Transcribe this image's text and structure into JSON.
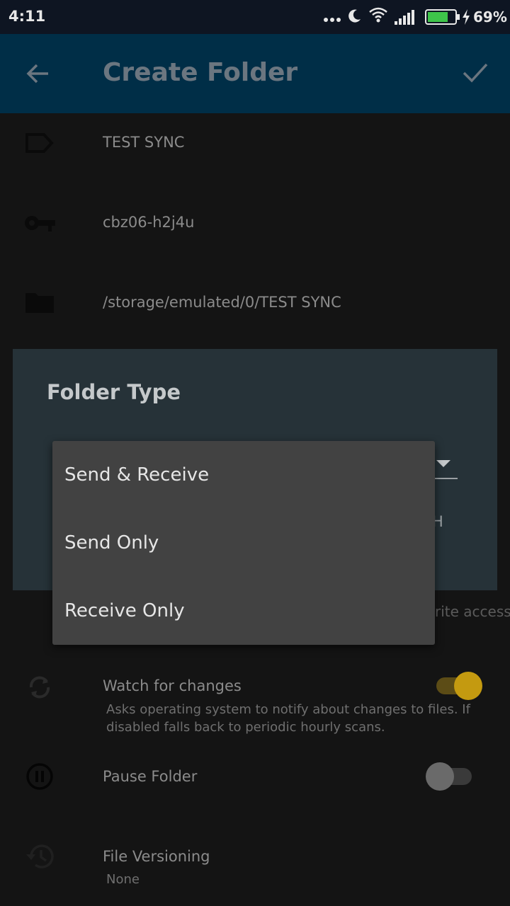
{
  "status_bar": {
    "time": "4:11",
    "battery_percent": "69%",
    "icons": [
      "more-dots-icon",
      "moon-icon",
      "wifi-icon",
      "signal-icon",
      "battery-icon",
      "charging-icon"
    ]
  },
  "app_bar": {
    "title": "Create Folder",
    "back_icon": "arrow-back-icon",
    "confirm_icon": "check-icon"
  },
  "fields": {
    "label": "TEST SYNC",
    "id": "cbz06-h2j4u",
    "path": "/storage/emulated/0/TEST SYNC"
  },
  "dialog": {
    "title": "Folder Type",
    "button_fragment": "H"
  },
  "folder_type_menu": {
    "options": [
      "Send & Receive",
      "Send Only",
      "Receive Only"
    ]
  },
  "background_partial_text": "rite access",
  "settings": {
    "watch": {
      "title": "Watch for changes",
      "description": "Asks operating system to notify about changes to files. If disabled falls back to periodic hourly scans.",
      "enabled": true
    },
    "pause": {
      "title": "Pause Folder",
      "enabled": false
    },
    "versioning": {
      "title": "File Versioning",
      "value": "None"
    }
  },
  "colors": {
    "app_bar": "#002e47",
    "status_bar": "#0e1522",
    "dialog": "#263238",
    "menu": "#424242",
    "toggle_on_thumb": "#c49a10",
    "toggle_on_track": "#5c4c16"
  }
}
